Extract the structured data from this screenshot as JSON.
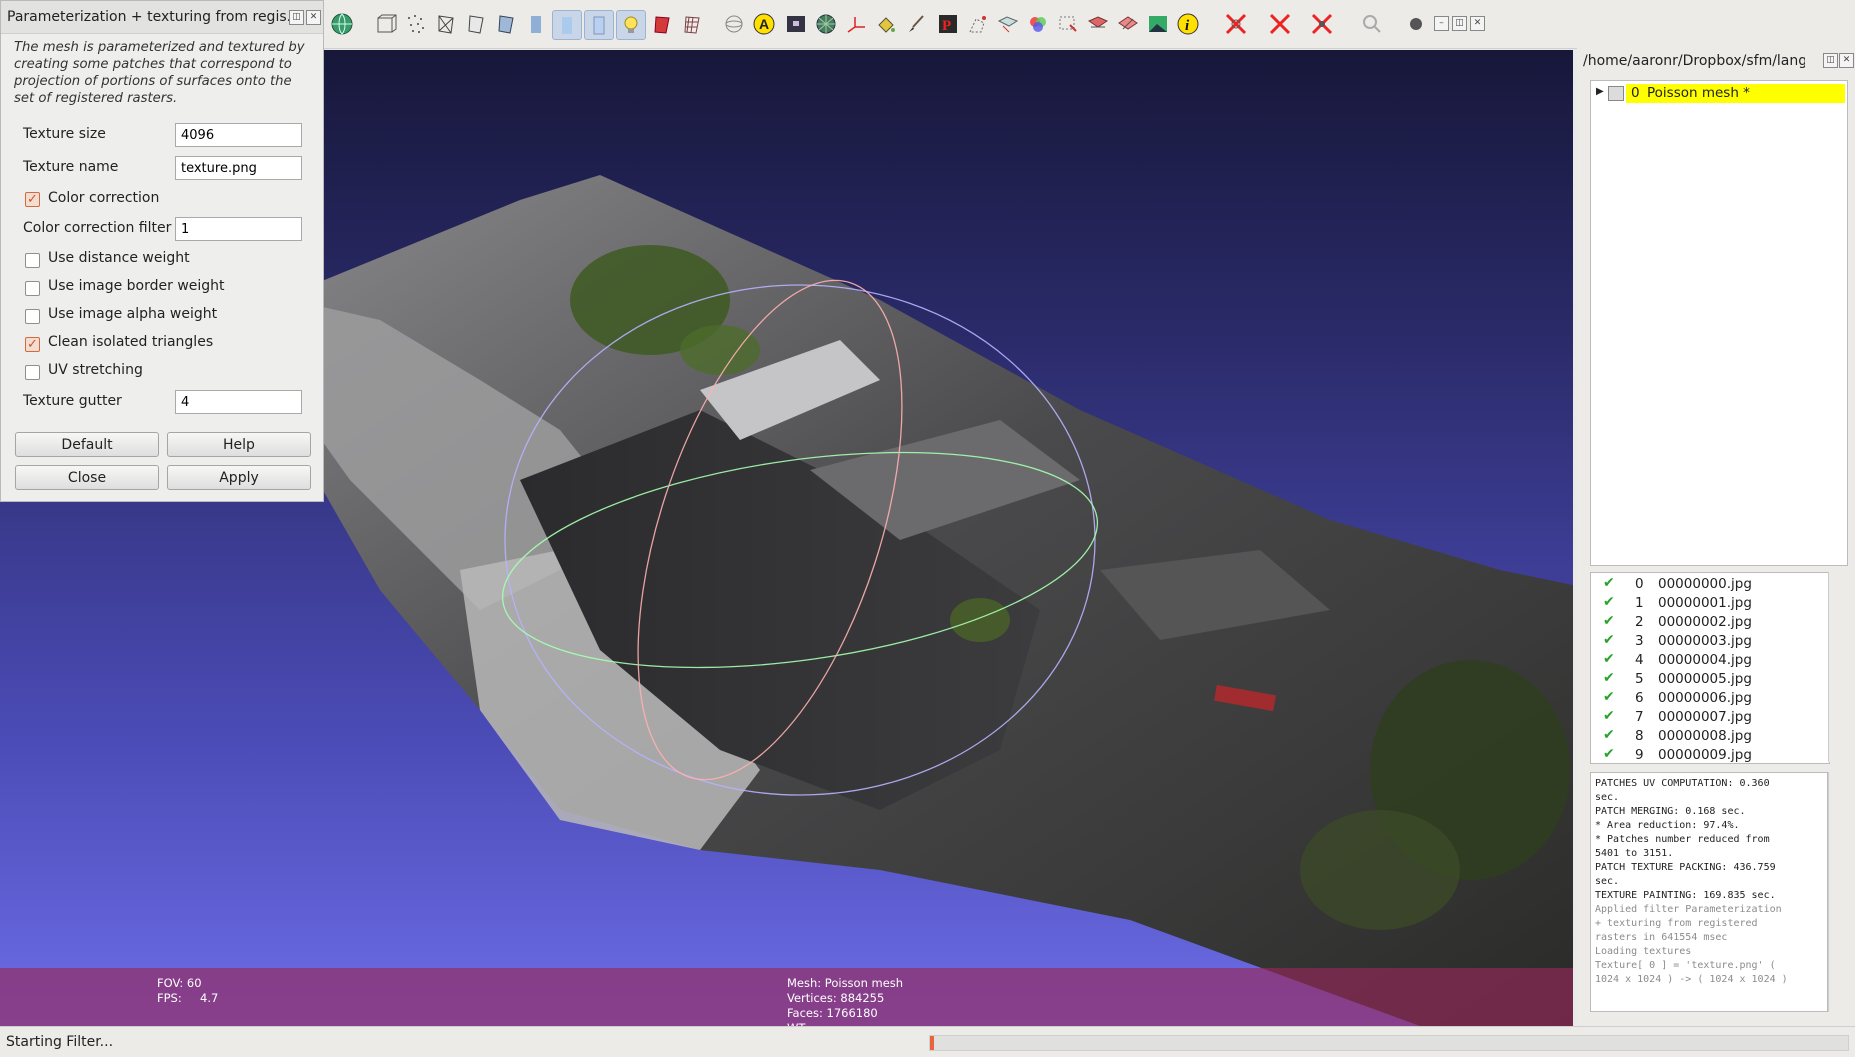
{
  "dialog": {
    "title": "Parameterization + texturing from regis...",
    "description": "The mesh is parameterized and textured by creating some patches that correspond to projection of portions of surfaces onto the set of registered rasters.",
    "fields": {
      "texture_size": {
        "label": "Texture size",
        "value": "4096"
      },
      "texture_name": {
        "label": "Texture name",
        "value": "texture.png"
      },
      "color_correction_filter": {
        "label": "Color correction filter",
        "value": "1"
      },
      "texture_gutter": {
        "label": "Texture gutter",
        "value": "4"
      }
    },
    "checkboxes": {
      "color_correction": {
        "label": "Color correction",
        "checked": true
      },
      "use_distance_weight": {
        "label": "Use distance weight",
        "checked": false
      },
      "use_image_border_weight": {
        "label": "Use image border weight",
        "checked": false
      },
      "use_image_alpha_weight": {
        "label": "Use image alpha weight",
        "checked": false
      },
      "clean_isolated_triangles": {
        "label": "Clean isolated triangles",
        "checked": true
      },
      "uv_stretching": {
        "label": "UV stretching",
        "checked": false
      }
    },
    "buttons": {
      "default": "Default",
      "help": "Help",
      "close": "Close",
      "apply": "Apply"
    }
  },
  "viewport": {
    "fov_line": "FOV: 60",
    "fps_line": "FPS:     4.7",
    "mesh_line": "Mesh: Poisson mesh",
    "vertices_line": "Vertices: 884255",
    "faces_line": "Faces: 1766180",
    "wt_line": "WT"
  },
  "right_panel": {
    "path": "/home/aaronr/Dropbox/sfm/lang...",
    "layer": {
      "index": "0",
      "name": "Poisson mesh *"
    },
    "rasters": [
      {
        "index": "0",
        "file": "00000000.jpg"
      },
      {
        "index": "1",
        "file": "00000001.jpg"
      },
      {
        "index": "2",
        "file": "00000002.jpg"
      },
      {
        "index": "3",
        "file": "00000003.jpg"
      },
      {
        "index": "4",
        "file": "00000004.jpg"
      },
      {
        "index": "5",
        "file": "00000005.jpg"
      },
      {
        "index": "6",
        "file": "00000006.jpg"
      },
      {
        "index": "7",
        "file": "00000007.jpg"
      },
      {
        "index": "8",
        "file": "00000008.jpg"
      },
      {
        "index": "9",
        "file": "00000009.jpg"
      }
    ],
    "log": [
      "PATCHES UV COMPUTATION: 0.360",
      "sec.",
      "PATCH MERGING: 0.168 sec.",
      "* Area reduction: 97.4%.",
      "* Patches number reduced from",
      "5401 to 3151.",
      "PATCH TEXTURE PACKING: 436.759",
      "sec.",
      "TEXTURE PAINTING: 169.835 sec.",
      "Applied filter Parameterization",
      "+ texturing from registered",
      "rasters in 641554 msec",
      "Loading textures",
      "Texture[ 0 ] = 'texture.png' (",
      "1024 x 1024 ) -> ( 1024 x 1024 )"
    ]
  },
  "status": {
    "text": "Starting Filter...",
    "progress": 0.004
  },
  "colors": {
    "selection": "#ffff00",
    "check_green": "#27a32b",
    "accent_orange": "#e8643c"
  },
  "toolbar_icons": [
    "globe-icon",
    "wireframe-box-icon",
    "points-icon",
    "wireframe-icon",
    "hidden-lines-icon",
    "flat-lines-icon",
    "flat-icon",
    "smooth-icon",
    "texture-icon",
    "light-bulb-icon",
    "red-texture-icon",
    "grid-texture-icon",
    "sphere-icon",
    "annotation-a-icon",
    "raster-camera-icon",
    "mesh-sphere-icon",
    "axes-icon",
    "paint-bucket-icon",
    "brush-icon",
    "pick-p-icon",
    "select-vertices-icon",
    "select-faces-icon",
    "paint-color-icon",
    "select-connected-icon",
    "delete-vertices-icon",
    "delete-faces-icon",
    "image-layer-icon",
    "info-icon",
    "delete-selected-icon",
    "delete-faces-red-icon",
    "delete-vertices-red-icon",
    "search-icon"
  ]
}
